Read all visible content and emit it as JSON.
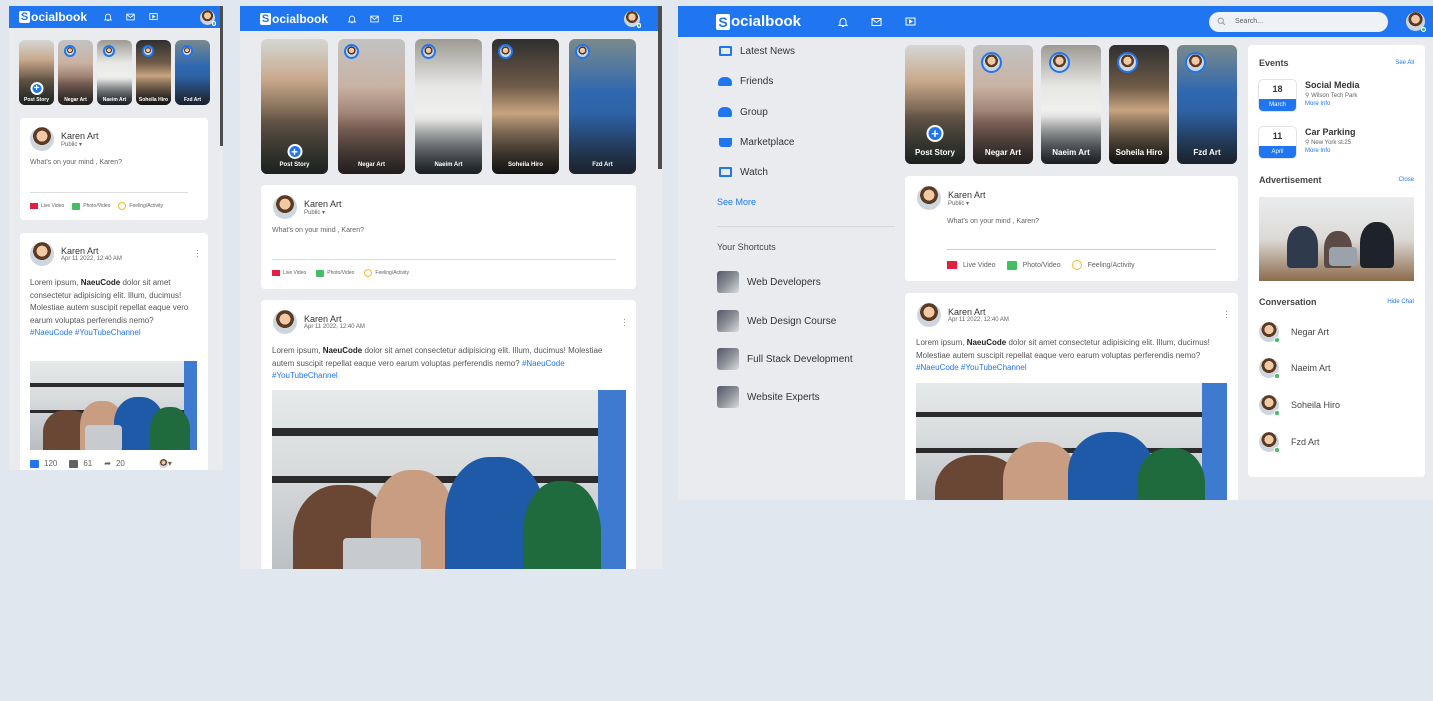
{
  "brand": {
    "letter": "S",
    "rest": "ocialbook"
  },
  "search": {
    "placeholder": "Search..."
  },
  "stories": [
    {
      "name": "Post Story",
      "own": true
    },
    {
      "name": "Negar Art"
    },
    {
      "name": "Naeim Art"
    },
    {
      "name": "Soheila Hiro"
    },
    {
      "name": "Fzd Art"
    }
  ],
  "composer": {
    "user": "Karen Art",
    "privacy": "Public",
    "placeholder": "What's on your mind , Karen?",
    "actions": [
      "Live Video",
      "Photo/Video",
      "Feeling/Activity"
    ]
  },
  "post": {
    "user": "Karen Art",
    "time": "Apr 11 2022, 12:40 AM",
    "text_before": "Lorem ipsum, ",
    "text_bold": "NaeuCode",
    "text_after": " dolor sit amet consectetur adipisicing elit. Illum, ducimus! Molestiae autem suscipit repellat eaque vero earum voluptas perferendis nemo?",
    "tags": "#NaeuCode #YouTubeChannel",
    "likes": "120",
    "comments": "61",
    "shares": "20"
  },
  "sidebar": {
    "items": [
      "Latest News",
      "Friends",
      "Group",
      "Marketplace",
      "Watch"
    ],
    "see_more": "See More",
    "shortcuts_title": "Your Shortcuts",
    "shortcuts": [
      "Web Developers",
      "Web Design Course",
      "Full Stack Development",
      "Website Experts"
    ]
  },
  "right": {
    "events_title": "Events",
    "see_all": "See All",
    "events": [
      {
        "day": "18",
        "month": "March",
        "title": "Social Media",
        "place": "Wilson Tech Park",
        "more": "More Info"
      },
      {
        "day": "11",
        "month": "April",
        "title": "Car Parking",
        "place": "New York st.25",
        "more": "More Info"
      }
    ],
    "ad_title": "Advertisement",
    "ad_close": "Close",
    "conv_title": "Conversation",
    "hide_chat": "Hide Chat",
    "contacts": [
      "Negar Art",
      "Naeim Art",
      "Soheila Hiro",
      "Fzd Art"
    ]
  },
  "colors": {
    "brand": "#1f76f0",
    "page": "#e1e7ef",
    "live": "#e41e3f",
    "photo": "#45bd62",
    "feeling": "#f7b928"
  }
}
